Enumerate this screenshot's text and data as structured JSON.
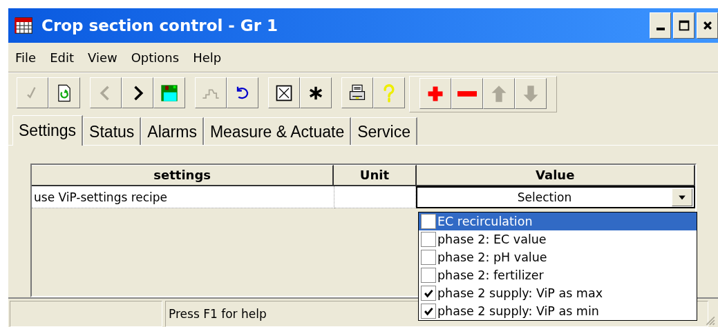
{
  "window": {
    "title": "Crop section control - Gr 1"
  },
  "menu": [
    "File",
    "Edit",
    "View",
    "Options",
    "Help"
  ],
  "toolbar": [
    [
      {
        "kind": "check",
        "disabled": true
      },
      {
        "kind": "refresh",
        "disabled": false
      }
    ],
    [
      {
        "kind": "back",
        "disabled": true
      },
      {
        "kind": "forward",
        "disabled": false
      },
      {
        "kind": "save",
        "disabled": false
      }
    ],
    [
      {
        "kind": "chart",
        "disabled": true
      },
      {
        "kind": "undo",
        "disabled": false
      }
    ],
    [
      {
        "kind": "cross",
        "disabled": false
      },
      {
        "kind": "asterisk",
        "disabled": false
      }
    ],
    [
      {
        "kind": "print",
        "disabled": false
      },
      {
        "kind": "help",
        "disabled": false
      }
    ],
    [
      {
        "kind": "add",
        "disabled": false
      },
      {
        "kind": "remove",
        "disabled": false
      },
      {
        "kind": "up",
        "disabled": true
      },
      {
        "kind": "down",
        "disabled": true
      }
    ]
  ],
  "tabs": [
    {
      "label": "Settings",
      "selected": true
    },
    {
      "label": "Status",
      "selected": false
    },
    {
      "label": "Alarms",
      "selected": false
    },
    {
      "label": "Measure & Actuate",
      "selected": false
    },
    {
      "label": "Service",
      "selected": false
    }
  ],
  "table": {
    "columns": [
      "settings",
      "Unit",
      "Value"
    ],
    "rows": [
      {
        "setting": "use ViP-settings recipe",
        "unit": "",
        "value": "Selection"
      }
    ]
  },
  "dropdown": {
    "items": [
      {
        "label": "EC recirculation",
        "checked": false,
        "selected": true
      },
      {
        "label": "phase 2: EC value",
        "checked": false,
        "selected": false
      },
      {
        "label": "phase 2: pH value",
        "checked": false,
        "selected": false
      },
      {
        "label": "phase 2: fertilizer",
        "checked": false,
        "selected": false
      },
      {
        "label": "phase 2 supply: ViP as max",
        "checked": true,
        "selected": false
      },
      {
        "label": "phase 2 supply: ViP as min",
        "checked": true,
        "selected": false
      }
    ]
  },
  "status_bar": {
    "panel_2": "Press F1 for help"
  }
}
